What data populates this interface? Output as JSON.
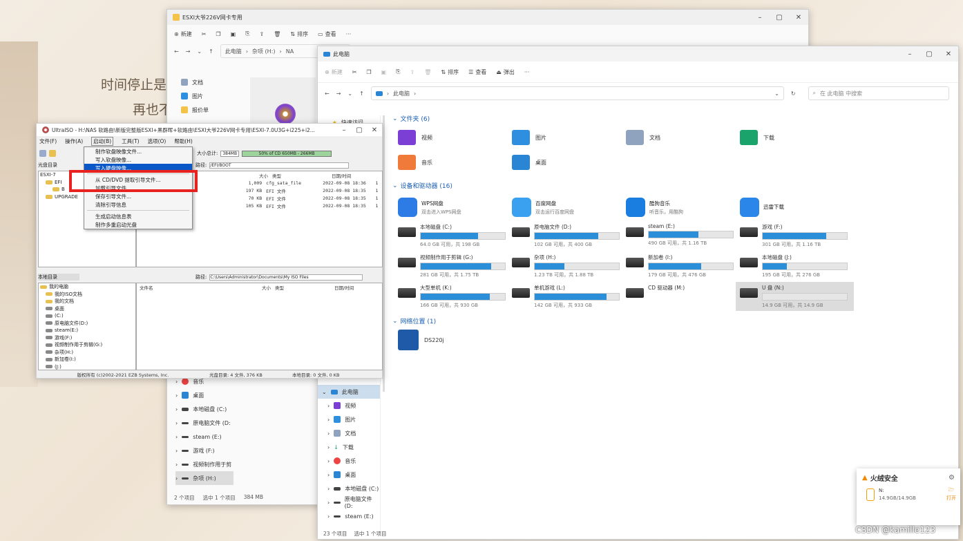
{
  "bg": {
    "line1": "时间停止是",
    "line2": "再也不"
  },
  "back_window": {
    "title": "ESXI大爷226V网卡专用",
    "cmd": [
      "新建",
      "排序",
      "查看"
    ],
    "crumbs": [
      "此电脑",
      "杂项 (H:)",
      "NA"
    ],
    "nav_top": [
      "文档",
      "图片",
      "报价单"
    ],
    "nav_bottom": [
      "音乐",
      "桌面",
      "本地磁盘 (C:)",
      "原电脑文件 (D:",
      "steam (E:)",
      "游戏 (F:)",
      "视频制作用于剪",
      "杂项 (H:)"
    ],
    "status": {
      "count": "2 个项目",
      "selected": "选中 1 个项目",
      "size": "384 MB"
    }
  },
  "main_window": {
    "title": "此电脑",
    "cmd": {
      "new": "新建",
      "sort": "排序",
      "view": "查看",
      "eject": "弹出"
    },
    "address": "此电脑",
    "search_placeholder": "在 此电脑 中搜索",
    "quick_access": "快速访问",
    "sections": {
      "folders": "文件夹 (6)",
      "drives": "设备和驱动器 (16)",
      "network": "网络位置 (1)"
    },
    "folders": [
      {
        "name": "视频",
        "color": "#7b3fd6"
      },
      {
        "name": "图片",
        "color": "#2e8fe0"
      },
      {
        "name": "文档",
        "color": "#8fa3bf"
      },
      {
        "name": "下载",
        "color": "#1aa36b"
      },
      {
        "name": "音乐",
        "color": "#f07a3a"
      },
      {
        "name": "桌面",
        "color": "#2a86d4"
      }
    ],
    "apps": [
      {
        "name": "WPS网盘",
        "sub": "双击进入WPS网盘",
        "color": "#2d7be5"
      },
      {
        "name": "百度网盘",
        "sub": "双击运行百度网盘",
        "color": "#3aa0f0"
      },
      {
        "name": "酷狗音乐",
        "sub": "听音乐，用酷狗",
        "color": "#1a7de0"
      },
      {
        "name": "迅雷下载",
        "sub": "",
        "color": "#2a86e8"
      }
    ],
    "drives": [
      {
        "name": "本地磁盘 (C:)",
        "sub": "64.0 GB 可用，共 198 GB",
        "fill": 0.68
      },
      {
        "name": "原电脑文件 (D:)",
        "sub": "102 GB 可用，共 400 GB",
        "fill": 0.75
      },
      {
        "name": "steam (E:)",
        "sub": "490 GB 可用，共 1.16 TB",
        "fill": 0.59
      },
      {
        "name": "游戏 (F:)",
        "sub": "301 GB 可用，共 1.16 TB",
        "fill": 0.75
      },
      {
        "name": "视频制作用于剪辑 (G:)",
        "sub": "281 GB 可用，共 1.75 TB",
        "fill": 0.84
      },
      {
        "name": "杂项 (H:)",
        "sub": "1.23 TB 可用，共 1.88 TB",
        "fill": 0.35
      },
      {
        "name": "新加卷 (I:)",
        "sub": "179 GB 可用，共 476 GB",
        "fill": 0.62
      },
      {
        "name": "本地磁盘 (J:)",
        "sub": "195 GB 可用，共 276 GB",
        "fill": 0.29
      },
      {
        "name": "大型单机 (K:)",
        "sub": "166 GB 可用，共 930 GB",
        "fill": 0.82
      },
      {
        "name": "单机游戏 (L:)",
        "sub": "142 GB 可用，共 933 GB",
        "fill": 0.85
      },
      {
        "name": "CD 驱动器 (M:)",
        "sub": "",
        "fill": 0
      },
      {
        "name": "U 盘 (N:)",
        "sub": "14.9 GB 可用，共 14.9 GB",
        "fill": 0
      }
    ],
    "network": [
      {
        "name": "DS220j"
      }
    ],
    "nav": [
      "此电脑",
      "视频",
      "图片",
      "文档",
      "下载",
      "音乐",
      "桌面",
      "本地磁盘 (C:)",
      "原电脑文件 (D:",
      "steam (E:)"
    ],
    "status": {
      "count": "23 个项目",
      "selected": "选中 1 个项目"
    }
  },
  "ultraiso": {
    "title": "UltraISO - H:\\NAS 软路由\\新版完整版ESXI+黑群晖+软路由\\ESXI大爷226V网卡专用\\ESXI-7.0U3G+i225+i2...",
    "menu": [
      "文件(F)",
      "操作(A)",
      "启动(B)",
      "工具(T)",
      "选项(O)",
      "帮助(H)"
    ],
    "size_label": "大小总计:",
    "size_value": "384MB",
    "bar_text": "50% of CD 650MB - 266MB",
    "cd_label": "光盘目录",
    "path_label": "路径:",
    "path_value": "/EFI/BOOT",
    "local_label": "本地目录",
    "local_path": "C:\\Users\\Administrator\\Documents\\My ISO Files",
    "cols": [
      "大小",
      "类型",
      "日期/时间"
    ],
    "lcols": [
      "文件名",
      "大小",
      "类型",
      "日期/时间"
    ],
    "files": [
      [
        "1,009",
        "cfg_sata_file",
        "2022-09-08 18:36",
        "1"
      ],
      [
        "197 KB",
        "EFI 文件",
        "2022-09-08 18:35",
        "1"
      ],
      [
        "70 KB",
        "EFI 文件",
        "2022-09-08 18:35",
        "1"
      ],
      [
        "105 KB",
        "EFI 文件",
        "2022-09-08 18:35",
        "1"
      ]
    ],
    "tree": [
      "ESXI-7",
      "EFI",
      "B",
      "UPGRADE"
    ],
    "localtree": [
      "我的电脑",
      "我的ISO文档",
      "我的文档",
      "桌面",
      "(C:)",
      "原电脑文件(D:)",
      "steam(E:)",
      "游戏(F:)",
      "视频制作用于剪辑(G:)",
      "杂项(H:)",
      "新加卷(I:)",
      "(J:)"
    ],
    "status": {
      "copyright": "版权所有 (c)2002-2021 EZB Systems, Inc.",
      "cd": "光盘目录: 4 文件, 376 KB",
      "local": "本地目录: 0 文件, 0 KB"
    },
    "boot_menu": [
      "制作软盘映像文件...",
      "写入软盘映像...",
      "写入硬盘映像...",
      "",
      "从 CD/DVD 提取引导文件...",
      "加载引导文件...",
      "保存引导文件...",
      "清除引导信息",
      "生成启动信息表",
      "制作多重启动光盘"
    ]
  },
  "huorong": {
    "title": "火绒安全",
    "drive": "N:",
    "size": "14.9GB/14.9GB",
    "open": "打开"
  },
  "watermark": "CSDN @kamille123"
}
